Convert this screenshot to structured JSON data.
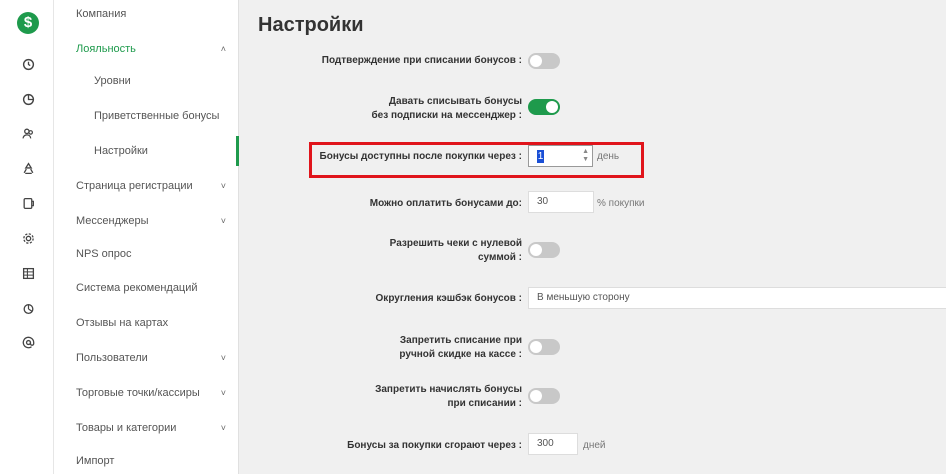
{
  "nav_rail": {
    "logo": "$",
    "icons": [
      "clock-icon",
      "chart-icon",
      "users-icon",
      "recycle-icon",
      "card-icon",
      "settings-icon",
      "table-icon",
      "piechart-icon",
      "at-icon"
    ]
  },
  "menu": {
    "items": [
      {
        "label": "Компания"
      },
      {
        "label": "Лояльность",
        "chevron": "˄"
      },
      {
        "label": "Уровни"
      },
      {
        "label": "Приветственные бонусы"
      },
      {
        "label": "Настройки"
      },
      {
        "label": "Страница регистрации",
        "chevron": "˅"
      },
      {
        "label": "Мессенджеры",
        "chevron": "˅"
      },
      {
        "label": "NPS опрос"
      },
      {
        "label": "Система рекомендаций"
      },
      {
        "label": "Отзывы на картах"
      },
      {
        "label": "Пользователи",
        "chevron": "˅"
      },
      {
        "label": "Торговые точки/кассиры",
        "chevron": "˅"
      },
      {
        "label": "Товары и категории",
        "chevron": "˅"
      },
      {
        "label": "Импорт"
      }
    ]
  },
  "page": {
    "title": "Настройки",
    "settings": [
      {
        "label": "Подтверждение при списании бонусов :",
        "toggle": false
      },
      {
        "label_line1": "Давать списывать бонусы",
        "label_line2": "без подписки на мессенджер :",
        "toggle": true
      },
      {
        "label": "Бонусы доступны после покупки через :",
        "value": "1",
        "unit": "день"
      },
      {
        "label": "Можно оплатить бонусами до:",
        "value": "30",
        "unit": "% покупки"
      },
      {
        "label_line1": "Разрешить чеки с нулевой",
        "label_line2": "суммой :",
        "toggle": false
      },
      {
        "label": "Округления кэшбэк бонусов :",
        "value": "В меньшую сторону"
      },
      {
        "label_line1": "Запретить списание при",
        "label_line2": "ручной скидке на кассе :",
        "toggle": false
      },
      {
        "label_line1": "Запретить начислять бонусы",
        "label_line2": "при списании :",
        "toggle": false
      },
      {
        "label": "Бонусы за покупки сгорают через :",
        "value": "300",
        "unit": "дней"
      }
    ]
  },
  "colors": {
    "accent": "#1e9a4c",
    "highlight": "#e0141b"
  }
}
